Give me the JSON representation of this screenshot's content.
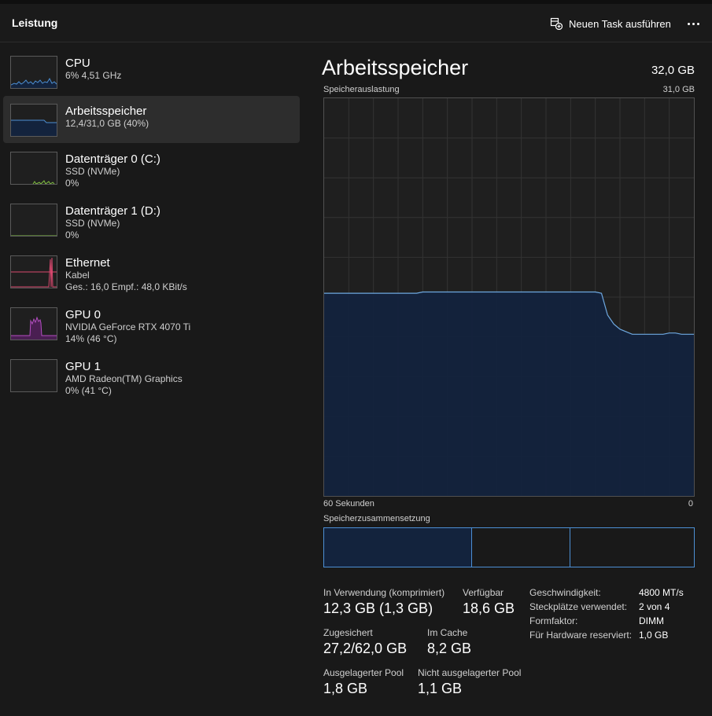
{
  "header": {
    "title": "Leistung",
    "run_task_label": "Neuen Task ausführen",
    "more_icon": "more-icon"
  },
  "sidebar": {
    "items": [
      {
        "name": "CPU",
        "line1": "6% 4,51 GHz",
        "line2": "",
        "color": "#4c8fd4"
      },
      {
        "name": "Arbeitsspeicher",
        "line1": "12,4/31,0 GB (40%)",
        "line2": "",
        "color": "#4c8fd4"
      },
      {
        "name": "Datenträger 0 (C:)",
        "line1": "SSD (NVMe)",
        "line2": "0%",
        "color": "#7fbf3f"
      },
      {
        "name": "Datenträger 1 (D:)",
        "line1": "SSD (NVMe)",
        "line2": "0%",
        "color": "#7fbf3f"
      },
      {
        "name": "Ethernet",
        "line1": "Kabel",
        "line2": "Ges.: 16,0 Empf.: 48,0 KBit/s",
        "color": "#d9486e"
      },
      {
        "name": "GPU 0",
        "line1": "NVIDIA GeForce RTX 4070 Ti",
        "line2": "14%  (46 °C)",
        "color": "#b44ec2"
      },
      {
        "name": "GPU 1",
        "line1": "AMD Radeon(TM) Graphics",
        "line2": "0%  (41 °C)",
        "color": "#b44ec2"
      }
    ],
    "selected_index": 1
  },
  "main": {
    "title": "Arbeitsspeicher",
    "total": "32,0 GB",
    "chart_label": "Speicherauslastung",
    "chart_max": "31,0 GB",
    "axis_left": "60 Sekunden",
    "axis_right": "0",
    "composition_label": "Speicherzusammensetzung",
    "composition": {
      "in_use_fraction": 0.4,
      "modified_fraction": 0.265
    },
    "stats": {
      "in_use_label": "In Verwendung (komprimiert)",
      "in_use_value": "12,3 GB (1,3 GB)",
      "available_label": "Verfügbar",
      "available_value": "18,6 GB",
      "committed_label": "Zugesichert",
      "committed_value": "27,2/62,0 GB",
      "cached_label": "Im Cache",
      "cached_value": "8,2 GB",
      "paged_label": "Ausgelagerter Pool",
      "paged_value": "1,8 GB",
      "nonpaged_label": "Nicht ausgelagerter Pool",
      "nonpaged_value": "1,1 GB"
    },
    "details": [
      {
        "key": "Geschwindigkeit:",
        "value": "4800 MT/s"
      },
      {
        "key": "Steckplätze verwendet:",
        "value": "2 von 4"
      },
      {
        "key": "Formfaktor:",
        "value": "DIMM"
      },
      {
        "key": "Für Hardware reserviert:",
        "value": "1,0 GB"
      }
    ]
  },
  "chart_data": {
    "type": "area",
    "x_range": [
      60,
      0
    ],
    "ylim": [
      0,
      31.0
    ],
    "y_unit": "GB",
    "values": [
      15.8,
      15.8,
      15.8,
      15.8,
      15.8,
      15.8,
      15.8,
      15.8,
      15.8,
      15.8,
      15.8,
      15.8,
      15.8,
      15.8,
      15.8,
      15.8,
      15.9,
      15.9,
      15.9,
      15.9,
      15.9,
      15.9,
      15.9,
      15.9,
      15.9,
      15.9,
      15.9,
      15.9,
      15.9,
      15.9,
      15.9,
      15.9,
      15.9,
      15.9,
      15.9,
      15.9,
      15.9,
      15.9,
      15.9,
      15.9,
      15.9,
      15.9,
      15.9,
      15.9,
      15.9,
      15.8,
      14.1,
      13.4,
      13.0,
      12.8,
      12.6,
      12.6,
      12.6,
      12.6,
      12.6,
      12.6,
      12.7,
      12.7,
      12.6,
      12.6,
      12.6
    ],
    "colors": {
      "line": "#6ea8e0",
      "fill": "#13233d",
      "grid": "#333333"
    }
  }
}
